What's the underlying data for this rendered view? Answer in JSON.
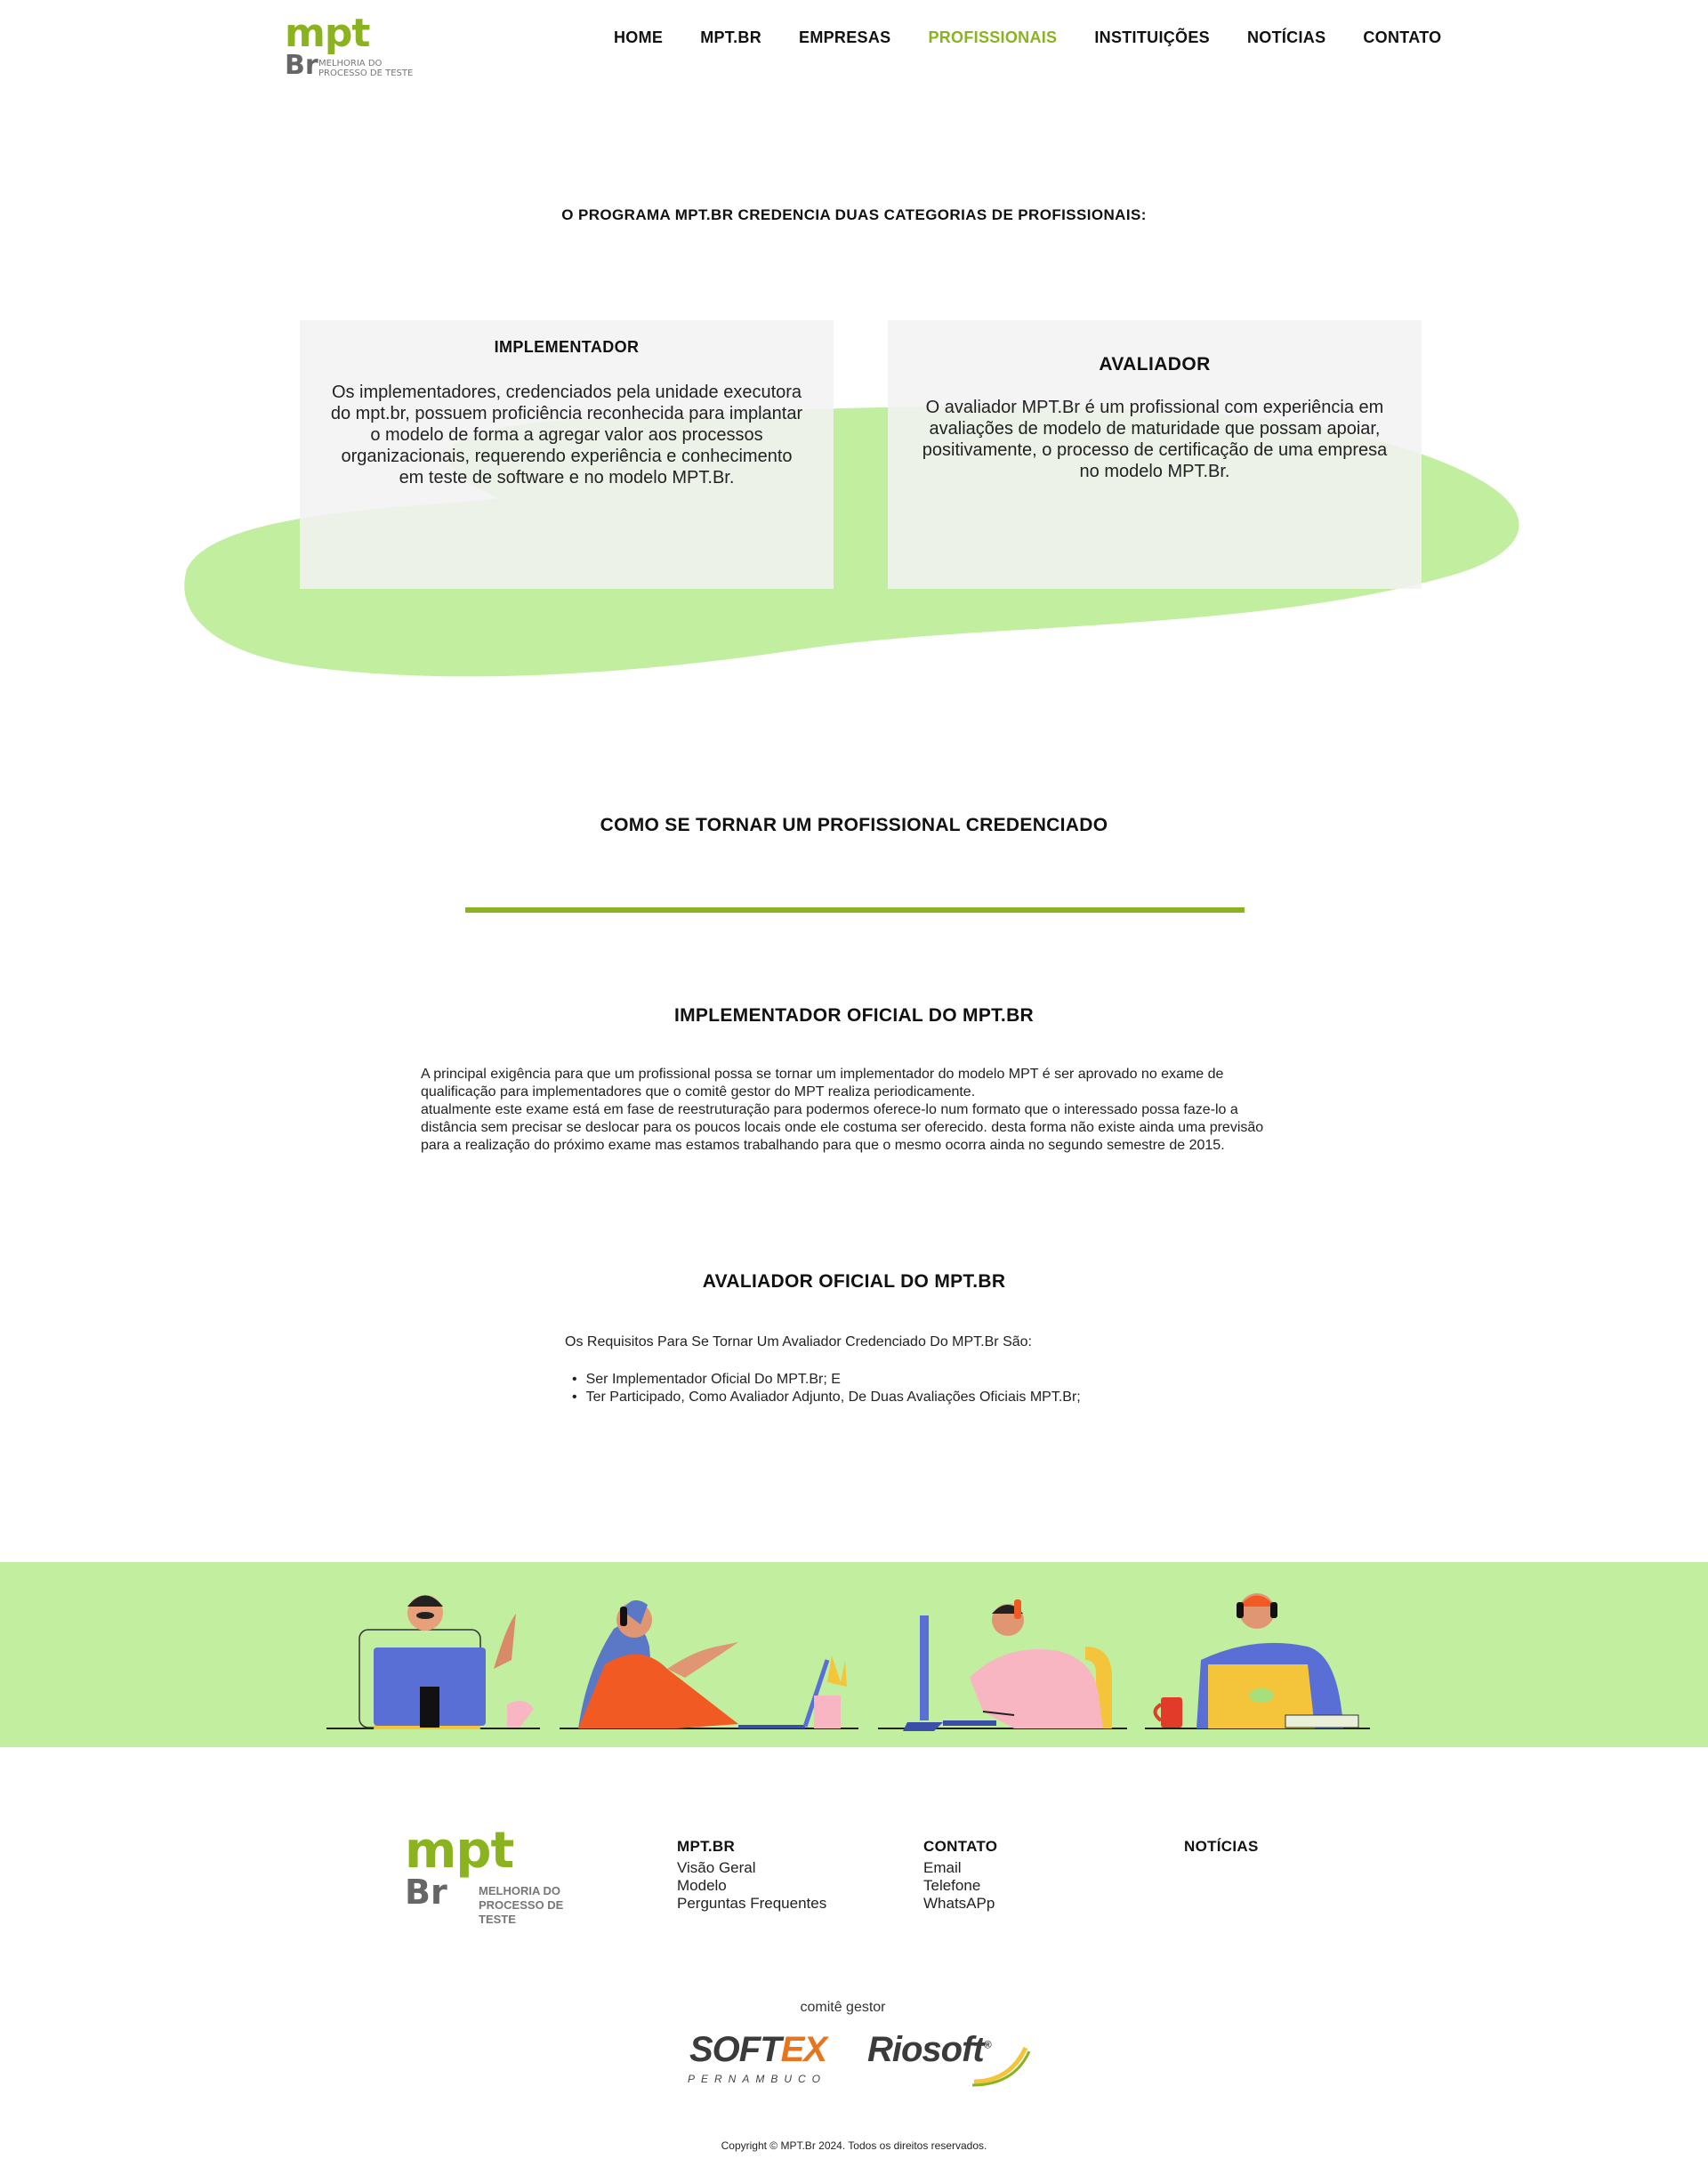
{
  "header": {
    "logo": {
      "mpt": "mpt",
      "br": "Br",
      "tagline": "MELHORIA DO PROCESSO DE TESTE"
    },
    "nav": [
      {
        "label": "HOME",
        "active": false
      },
      {
        "label": "MPT.BR",
        "active": false
      },
      {
        "label": "EMPRESAS",
        "active": false
      },
      {
        "label": "PROFISSIONAIS",
        "active": true
      },
      {
        "label": "INSTITUIÇÕES",
        "active": false
      },
      {
        "label": "NOTÍCIAS",
        "active": false
      },
      {
        "label": "CONTATO",
        "active": false
      }
    ]
  },
  "intro": {
    "title": "O PROGRAMA MPT.BR CREDENCIA DUAS CATEGORIAS DE PROFISSIONAIS:",
    "cards": [
      {
        "title": "IMPLEMENTADOR",
        "text": "Os implementadores, credenciados pela unidade executora do mpt.br, possuem proficiência reconhecida para implantar o modelo de forma a agregar valor aos processos organizacionais, requerendo experiência e conhecimento em teste de software e no modelo MPT.Br."
      },
      {
        "title": "AVALIADOR",
        "text": "O avaliador MPT.Br é um profissional com experiência em avaliações de modelo de maturidade que possam apoiar, positivamente, o processo de certificação de uma empresa no modelo MPT.Br."
      }
    ]
  },
  "how": {
    "title": "COMO SE TORNAR UM PROFISSIONAL CREDENCIADO",
    "implementador": {
      "title": "IMPLEMENTADOR OFICIAL DO MPT.BR",
      "paragraph1": "A principal exigência para que um profissional possa se tornar um implementador do modelo MPT é ser aprovado no exame de qualificação para implementadores que o comitê gestor do MPT realiza periodicamente.",
      "paragraph2": "atualmente este exame está em fase de reestruturação para podermos oferece-lo num formato que o interessado possa faze-lo a distância sem precisar se deslocar para os poucos locais onde ele costuma ser oferecido. desta forma não existe ainda uma previsão para a realização do próximo exame mas estamos trabalhando para que o mesmo ocorra ainda no segundo semestre de 2015."
    },
    "avaliador": {
      "title": "AVALIADOR OFICIAL DO MPT.BR",
      "intro": "Os Requisitos Para Se Tornar Um Avaliador Credenciado Do MPT.Br São:",
      "items": [
        "Ser Implementador Oficial Do MPT.Br; E",
        "Ter Participado, Como Avaliador Adjunto, De Duas Avaliações Oficiais MPT.Br;"
      ]
    }
  },
  "footer": {
    "logo": {
      "mpt": "mpt",
      "br": "Br",
      "tagline": "MELHORIA DO PROCESSO DE TESTE"
    },
    "columns": [
      {
        "title": "MPT.BR",
        "links": [
          "Visão Geral",
          "Modelo",
          "Perguntas Frequentes"
        ]
      },
      {
        "title": "CONTATO",
        "links": [
          "Email",
          "Telefone",
          "WhatsAPp"
        ]
      },
      {
        "title": "NOTÍCIAS",
        "links": []
      }
    ],
    "comite_label": "comitê gestor",
    "partners": {
      "softex_a": "SOFT",
      "softex_b": "EX",
      "softex_sub": "PERNAMBUCO",
      "riosoft": "Riosoft",
      "riosoft_mark": "®"
    },
    "copyright": "Copyright © MPT.Br 2024. Todos os direitos reservados."
  },
  "colors": {
    "brand_green": "#8bb21f",
    "blob_green": "#c2ef9f",
    "card_bg": "#f3f3f3",
    "softex_orange": "#e7751d"
  },
  "illustrations": [
    "person-headset-desktop-icon",
    "person-headset-laptop-icon",
    "person-headset-monitor-icon",
    "person-headset-laptop-mug-icon"
  ]
}
